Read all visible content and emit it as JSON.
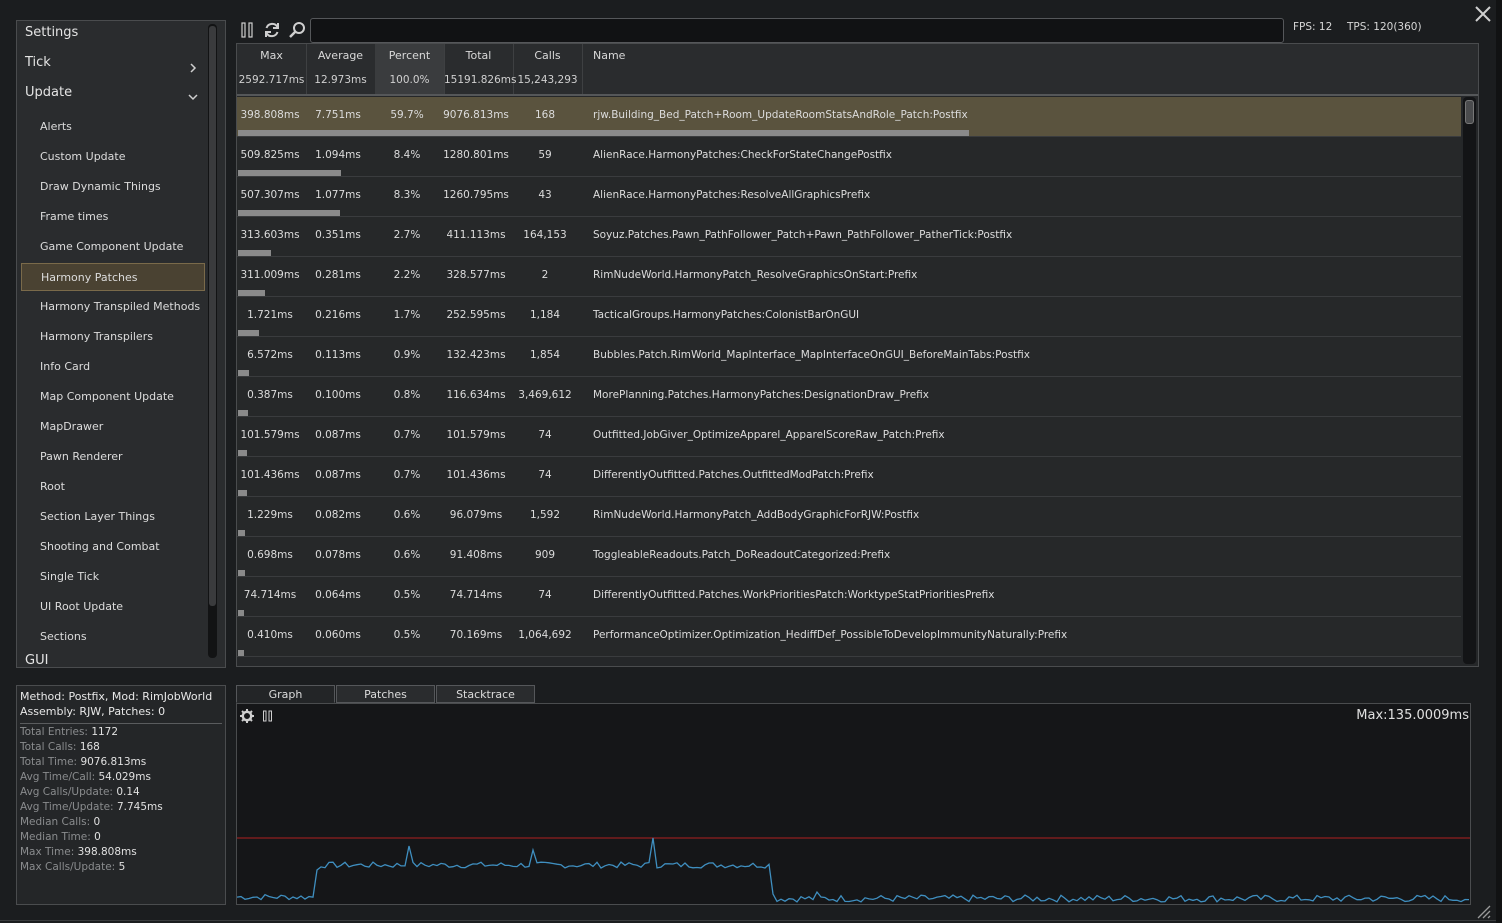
{
  "sidebar": {
    "headers": [
      {
        "label": "Settings"
      },
      {
        "label": "Tick",
        "state": "collapsed"
      },
      {
        "label": "Update",
        "state": "expanded"
      }
    ],
    "items": [
      {
        "label": "Alerts"
      },
      {
        "label": "Custom Update"
      },
      {
        "label": "Draw Dynamic Things"
      },
      {
        "label": "Frame times"
      },
      {
        "label": "Game Component Update"
      },
      {
        "label": "Harmony Patches",
        "selected": true
      },
      {
        "label": "Harmony Transpiled Methods"
      },
      {
        "label": "Harmony Transpilers"
      },
      {
        "label": "Info Card"
      },
      {
        "label": "Map Component Update"
      },
      {
        "label": "MapDrawer"
      },
      {
        "label": "Pawn Renderer"
      },
      {
        "label": "Root"
      },
      {
        "label": "Section Layer Things"
      },
      {
        "label": "Shooting and Combat"
      },
      {
        "label": "Single Tick"
      },
      {
        "label": "UI Root Update"
      },
      {
        "label": "Sections"
      }
    ],
    "cut_off_header": "GUI"
  },
  "toolbar": {
    "icons": [
      "pause-icon",
      "refresh-icon",
      "search-icon"
    ],
    "search_value": "",
    "fps": "FPS: 12",
    "tps": "TPS: 120(360)"
  },
  "table": {
    "columns": [
      {
        "title": "Max",
        "summary": "2592.717ms"
      },
      {
        "title": "Average",
        "summary": "12.973ms"
      },
      {
        "title": "Percent",
        "summary": "100.0%",
        "active": true
      },
      {
        "title": "Total",
        "summary": "15191.826ms"
      },
      {
        "title": "Calls",
        "summary": "15,243,293"
      },
      {
        "title": "Name",
        "summary": ""
      }
    ],
    "rows": [
      {
        "max": "398.808ms",
        "avg": "7.751ms",
        "pct": "59.7%",
        "total": "9076.813ms",
        "calls": "168",
        "name": "rjw.Building_Bed_Patch+Room_UpdateRoomStatsAndRole_Patch:Postfix",
        "share": 0.597,
        "selected": true
      },
      {
        "max": "509.825ms",
        "avg": "1.094ms",
        "pct": "8.4%",
        "total": "1280.801ms",
        "calls": "59",
        "name": "AlienRace.HarmonyPatches:CheckForStateChangePostfix",
        "share": 0.084
      },
      {
        "max": "507.307ms",
        "avg": "1.077ms",
        "pct": "8.3%",
        "total": "1260.795ms",
        "calls": "43",
        "name": "AlienRace.HarmonyPatches:ResolveAllGraphicsPrefix",
        "share": 0.083
      },
      {
        "max": "313.603ms",
        "avg": "0.351ms",
        "pct": "2.7%",
        "total": "411.113ms",
        "calls": "164,153",
        "name": "Soyuz.Patches.Pawn_PathFollower_Patch+Pawn_PathFollower_PatherTick:Postfix",
        "share": 0.027
      },
      {
        "max": "311.009ms",
        "avg": "0.281ms",
        "pct": "2.2%",
        "total": "328.577ms",
        "calls": "2",
        "name": "RimNudeWorld.HarmonyPatch_ResolveGraphicsOnStart:Prefix",
        "share": 0.022
      },
      {
        "max": "1.721ms",
        "avg": "0.216ms",
        "pct": "1.7%",
        "total": "252.595ms",
        "calls": "1,184",
        "name": "TacticalGroups.HarmonyPatches:ColonistBarOnGUI",
        "share": 0.017
      },
      {
        "max": "6.572ms",
        "avg": "0.113ms",
        "pct": "0.9%",
        "total": "132.423ms",
        "calls": "1,854",
        "name": "Bubbles.Patch.RimWorld_MapInterface_MapInterfaceOnGUI_BeforeMainTabs:Postfix",
        "share": 0.009
      },
      {
        "max": "0.387ms",
        "avg": "0.100ms",
        "pct": "0.8%",
        "total": "116.634ms",
        "calls": "3,469,612",
        "name": "MorePlanning.Patches.HarmonyPatches:DesignationDraw_Prefix",
        "share": 0.008
      },
      {
        "max": "101.579ms",
        "avg": "0.087ms",
        "pct": "0.7%",
        "total": "101.579ms",
        "calls": "74",
        "name": "Outfitted.JobGiver_OptimizeApparel_ApparelScoreRaw_Patch:Prefix",
        "share": 0.007
      },
      {
        "max": "101.436ms",
        "avg": "0.087ms",
        "pct": "0.7%",
        "total": "101.436ms",
        "calls": "74",
        "name": "DifferentlyOutfitted.Patches.OutfittedModPatch:Prefix",
        "share": 0.007
      },
      {
        "max": "1.229ms",
        "avg": "0.082ms",
        "pct": "0.6%",
        "total": "96.079ms",
        "calls": "1,592",
        "name": "RimNudeWorld.HarmonyPatch_AddBodyGraphicForRJW:Postfix",
        "share": 0.006
      },
      {
        "max": "0.698ms",
        "avg": "0.078ms",
        "pct": "0.6%",
        "total": "91.408ms",
        "calls": "909",
        "name": "ToggleableReadouts.Patch_DoReadoutCategorized:Prefix",
        "share": 0.006
      },
      {
        "max": "74.714ms",
        "avg": "0.064ms",
        "pct": "0.5%",
        "total": "74.714ms",
        "calls": "74",
        "name": "DifferentlyOutfitted.Patches.WorkPrioritiesPatch:WorktypeStatPrioritiesPrefix",
        "share": 0.005
      },
      {
        "max": "0.410ms",
        "avg": "0.060ms",
        "pct": "0.5%",
        "total": "70.169ms",
        "calls": "1,064,692",
        "name": "PerformanceOptimizer.Optimization_HediffDef_PossibleToDevelopImmunityNaturally:Prefix",
        "share": 0.005
      }
    ]
  },
  "info": {
    "line1": "Method: Postfix, Mod: RimJobWorld",
    "line2": "Assembly: RJW, Patches: 0",
    "stats": [
      {
        "key": "Total Entries:",
        "value": "1172"
      },
      {
        "key": "Total Calls:",
        "value": "168"
      },
      {
        "key": "Total Time:",
        "value": "9076.813ms"
      },
      {
        "key": "Avg Time/Call:",
        "value": "54.029ms"
      },
      {
        "key": "Avg Calls/Update:",
        "value": "0.14"
      },
      {
        "key": "Avg Time/Update:",
        "value": "7.745ms"
      },
      {
        "key": "Median Calls:",
        "value": "0"
      },
      {
        "key": "Median Time:",
        "value": "0"
      },
      {
        "key": "Max Time:",
        "value": "398.808ms"
      },
      {
        "key": "Max Calls/Update:",
        "value": "5"
      }
    ]
  },
  "bottom_tabs": [
    {
      "label": "Graph",
      "active": true
    },
    {
      "label": "Patches"
    },
    {
      "label": "Stacktrace"
    }
  ],
  "graph": {
    "max_label": "Max:135.0009ms",
    "icons": [
      "gear-icon",
      "pause-icon"
    ],
    "colors": {
      "line": "#3f8fc0",
      "threshold": "#b02020",
      "selection": "#5a533e",
      "bar": "#8a8a8a"
    }
  }
}
